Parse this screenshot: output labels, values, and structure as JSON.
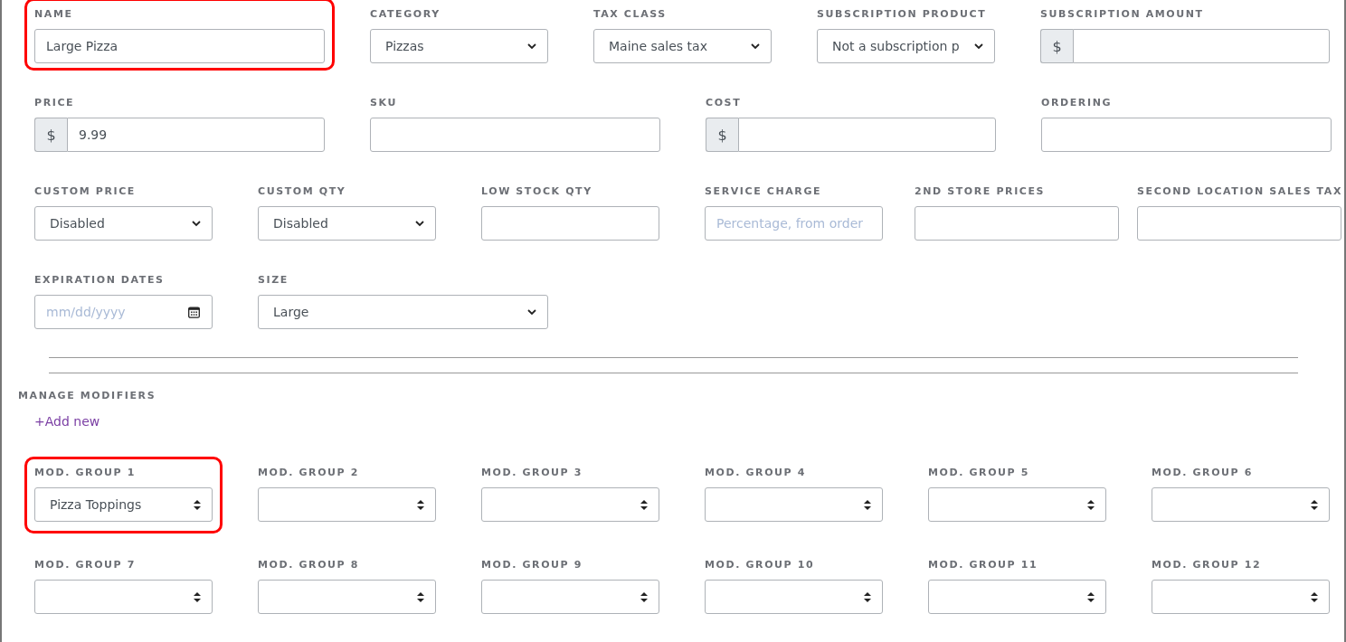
{
  "product_rows": [
    [
      {
        "label": "NAME",
        "kind": "text",
        "value": "Large Pizza",
        "highlighted": true
      },
      {
        "label": "CATEGORY",
        "kind": "select",
        "value": "Pizzas"
      },
      {
        "label": "TAX CLASS",
        "kind": "select",
        "value": "Maine sales tax"
      },
      {
        "label": "SUBSCRIPTION PRODUCT",
        "kind": "select",
        "value": "Not a subscription p"
      },
      {
        "label": "SUBSCRIPTION AMOUNT",
        "kind": "currency",
        "prefix": "$"
      }
    ],
    [
      {
        "label": "PRICE",
        "kind": "currency",
        "prefix": "$",
        "value": "9.99"
      },
      {
        "label": "SKU",
        "kind": "text"
      },
      {
        "label": "COST",
        "kind": "currency",
        "prefix": "$"
      },
      {
        "label": "ORDERING",
        "kind": "text"
      }
    ],
    [
      {
        "label": "CUSTOM PRICE",
        "kind": "select",
        "value": "Disabled"
      },
      {
        "label": "CUSTOM QTY",
        "kind": "select",
        "value": "Disabled"
      },
      {
        "label": "LOW STOCK QTY",
        "kind": "text"
      },
      {
        "label": "SERVICE CHARGE",
        "kind": "text",
        "placeholder": "Percentage, from order"
      },
      {
        "label": "2ND STORE PRICES",
        "kind": "text"
      },
      {
        "label": "SECOND LOCATION SALES TAX",
        "kind": "text"
      }
    ],
    [
      {
        "label": "EXPIRATION DATES",
        "kind": "date",
        "placeholder": "mm/dd/yyyy"
      },
      {
        "label": "SIZE",
        "kind": "select",
        "value": "Large"
      }
    ]
  ],
  "modifiers": {
    "title": "MANAGE MODIFIERS",
    "add_link": "+Add new",
    "groups": [
      {
        "label": "MOD. GROUP 1",
        "value": "Pizza Toppings",
        "highlighted": true
      },
      {
        "label": "MOD. GROUP 2"
      },
      {
        "label": "MOD. GROUP 3"
      },
      {
        "label": "MOD. GROUP 4"
      },
      {
        "label": "MOD. GROUP 5"
      },
      {
        "label": "MOD. GROUP 6"
      },
      {
        "label": "MOD. GROUP 7"
      },
      {
        "label": "MOD. GROUP 8"
      },
      {
        "label": "MOD. GROUP 9"
      },
      {
        "label": "MOD. GROUP 10"
      },
      {
        "label": "MOD. GROUP 11"
      },
      {
        "label": "MOD. GROUP 12"
      }
    ]
  }
}
